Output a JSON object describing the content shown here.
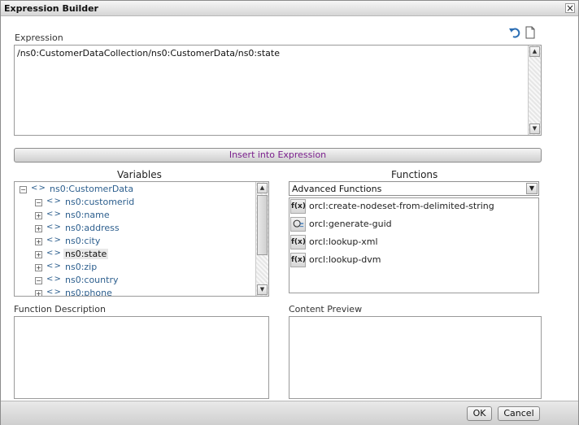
{
  "window": {
    "title": "Expression Builder",
    "close_symbol": "×"
  },
  "expression": {
    "label": "Expression",
    "value": "/ns0:CustomerDataCollection/ns0:CustomerData/ns0:state"
  },
  "insert_button": {
    "label": "Insert into Expression"
  },
  "variables": {
    "title": "Variables",
    "tree": [
      {
        "label": "ns0:CustomerData",
        "expander": "−",
        "level": 0
      },
      {
        "label": "ns0:customerid",
        "expander": "−",
        "level": 1
      },
      {
        "label": "ns0:name",
        "expander": "+",
        "level": 1
      },
      {
        "label": "ns0:address",
        "expander": "+",
        "level": 1
      },
      {
        "label": "ns0:city",
        "expander": "+",
        "level": 1
      },
      {
        "label": "ns0:state",
        "expander": "+",
        "level": 1,
        "selected": true
      },
      {
        "label": "ns0:zip",
        "expander": "+",
        "level": 1
      },
      {
        "label": "ns0:country",
        "expander": "−",
        "level": 1
      },
      {
        "label": "ns0:phone",
        "expander": "+",
        "level": 1
      }
    ],
    "node_icon": "< >"
  },
  "functions": {
    "title": "Functions",
    "category": "Advanced Functions",
    "items": [
      {
        "label": "orcl:create-nodeset-from-delimited-string",
        "icon": "f(x)"
      },
      {
        "label": "orcl:generate-guid",
        "icon": "guid-icon"
      },
      {
        "label": "orcl:lookup-xml",
        "icon": "f(x)"
      },
      {
        "label": "orcl:lookup-dvm",
        "icon": "f(x)"
      }
    ]
  },
  "function_description": {
    "label": "Function Description"
  },
  "content_preview": {
    "label": "Content Preview"
  },
  "buttons": {
    "ok": "OK",
    "cancel": "Cancel"
  },
  "colors": {
    "insert_text": "#7a1f8c",
    "tree_text": "#2d5f8e"
  }
}
